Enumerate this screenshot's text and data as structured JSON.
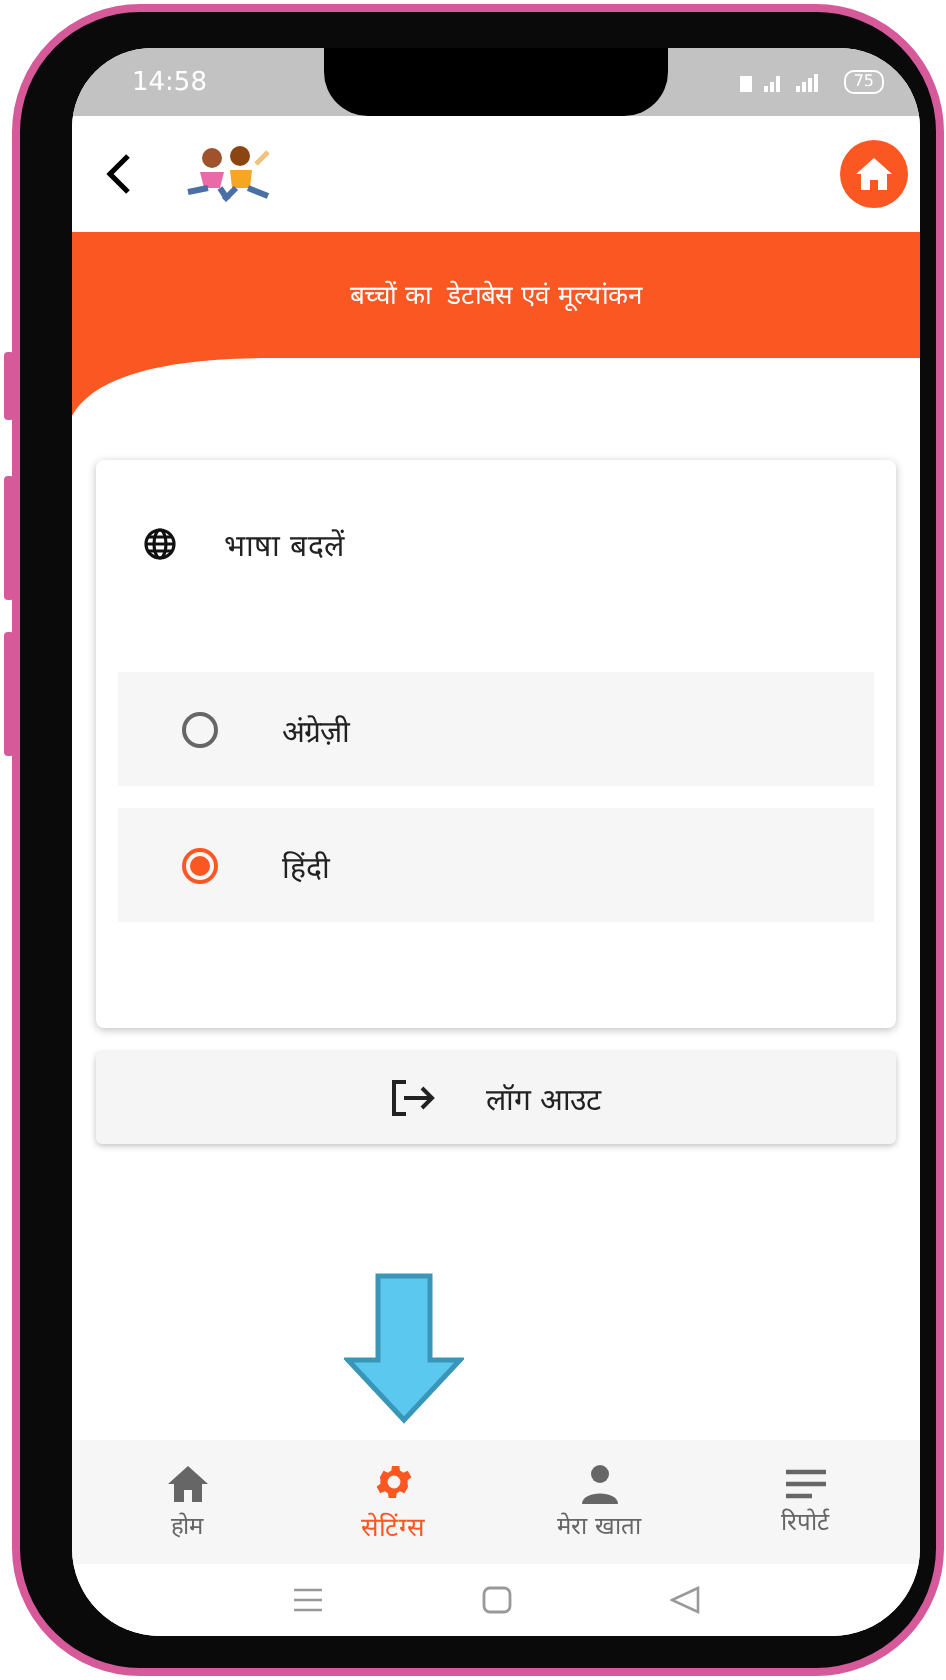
{
  "status_bar": {
    "time": "14:58",
    "battery": "75"
  },
  "header": {
    "title": "बच्चों का  डेटाबेस एवं मूल्यांकन"
  },
  "language_card": {
    "title": "भाषा बदलें",
    "options": [
      {
        "label": "अंग्रेज़ी",
        "selected": false
      },
      {
        "label": "हिंदी",
        "selected": true
      }
    ]
  },
  "logout_button": {
    "label": "लॉग आउट"
  },
  "bottom_nav": [
    {
      "kind": "home",
      "label": "होम",
      "selected": false
    },
    {
      "kind": "settings",
      "label": "सेटिंग्स",
      "selected": true
    },
    {
      "kind": "account",
      "label": "मेरा खाता",
      "selected": false
    },
    {
      "kind": "report",
      "label": "रिपोर्ट",
      "selected": false
    }
  ]
}
